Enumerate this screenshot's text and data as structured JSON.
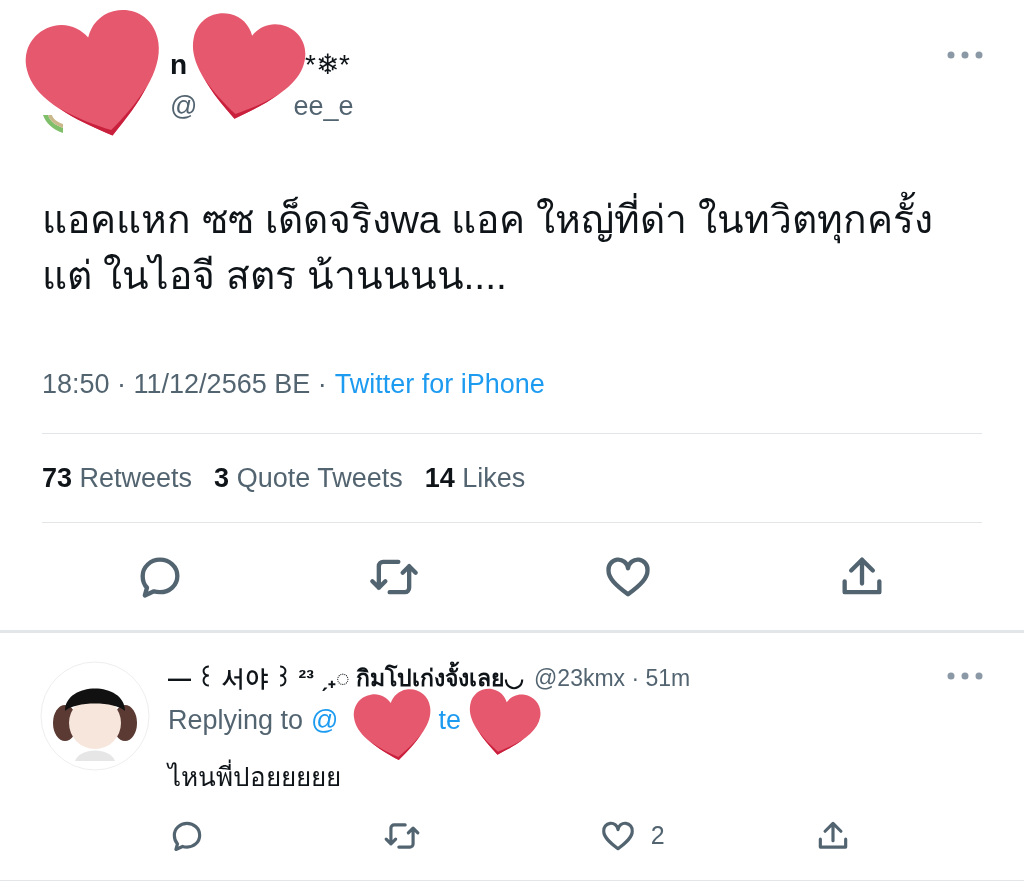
{
  "tweet": {
    "name_parts": [
      "n",
      "*❄*"
    ],
    "handle_parts": [
      "@",
      "ee_e"
    ],
    "text": "แอคแหก ซซ เด็ดจริงwa แอค ใหญ่ที่ด่า ในทวิตทุกครั้งแต่ ในไอจี สตร น้านนนน....",
    "meta": "18:50 · 11/12/2565 BE ·",
    "source": "Twitter for iPhone",
    "stats": [
      {
        "count": "73",
        "label": "Retweets"
      },
      {
        "count": "3",
        "label": "Quote Tweets"
      },
      {
        "count": "14",
        "label": "Likes"
      }
    ],
    "actions": [
      {
        "kind": "reply"
      },
      {
        "kind": "retweet"
      },
      {
        "kind": "like"
      },
      {
        "kind": "share"
      }
    ]
  },
  "reply": {
    "name": "— ꒰ 서야 ꒱ ²³ ˏ₊◌ กิมโปเก่งจั้งเลย◡",
    "handle": "@23kmx · 51m",
    "replying_to": "Replying to",
    "mention_parts": [
      "@",
      "te"
    ],
    "text": "ไหนพี่ปอยยยยย",
    "actions": [
      {
        "kind": "reply"
      },
      {
        "kind": "retweet"
      },
      {
        "kind": "like",
        "count": "2"
      },
      {
        "kind": "share"
      }
    ]
  }
}
